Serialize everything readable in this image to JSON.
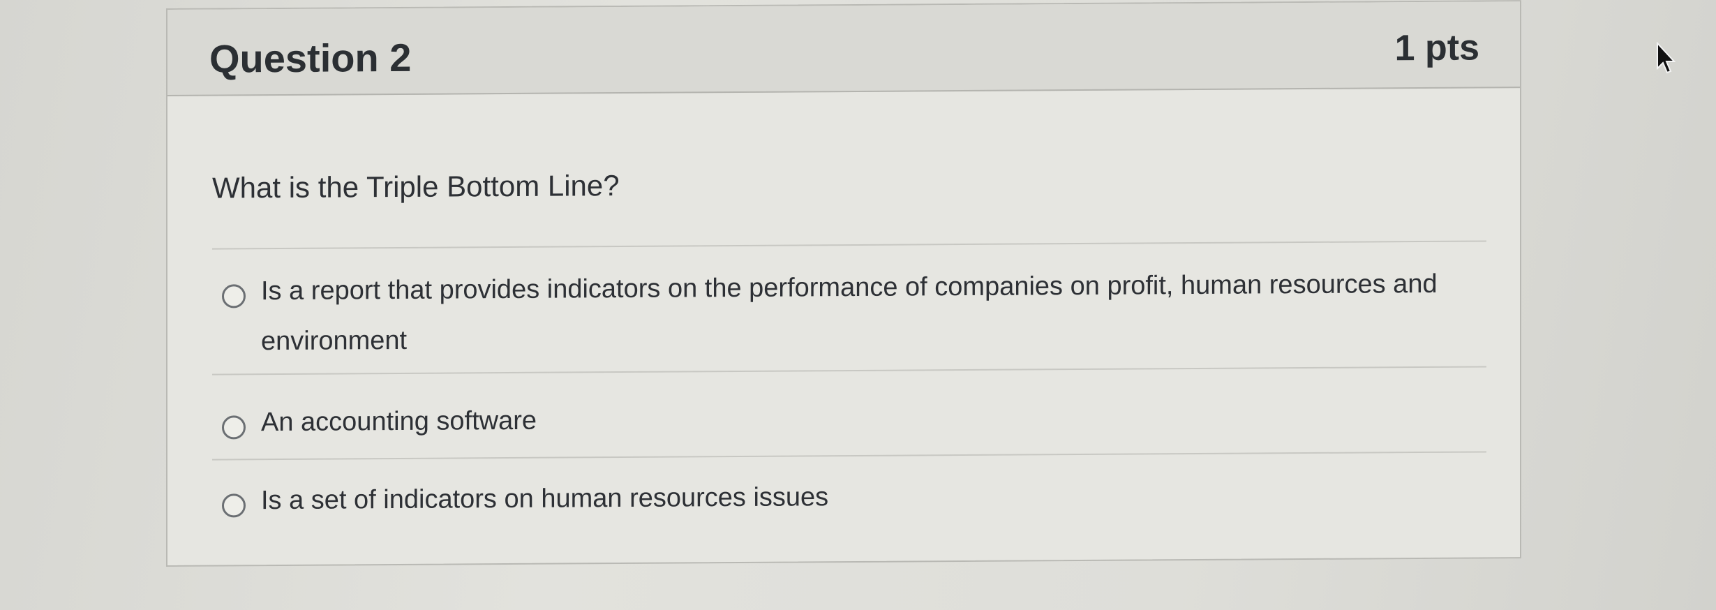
{
  "question": {
    "title": "Question 2",
    "points": "1 pts",
    "text": "What is the Triple Bottom Line?"
  },
  "answers": [
    {
      "label": "Is a report that provides indicators on the performance of companies on profit, human resources and environment",
      "selected": false
    },
    {
      "label": "An accounting software",
      "selected": false
    },
    {
      "label": "Is a set of indicators on human resources issues",
      "selected": false
    }
  ],
  "icons": {
    "cursor": "mouse-pointer-icon",
    "radio": "radio-unchecked-icon"
  },
  "colors": {
    "header_bg": "#d9d9d4",
    "card_bg": "#e6e6e1",
    "text": "#2d3035",
    "border": "#b9b9b4"
  }
}
